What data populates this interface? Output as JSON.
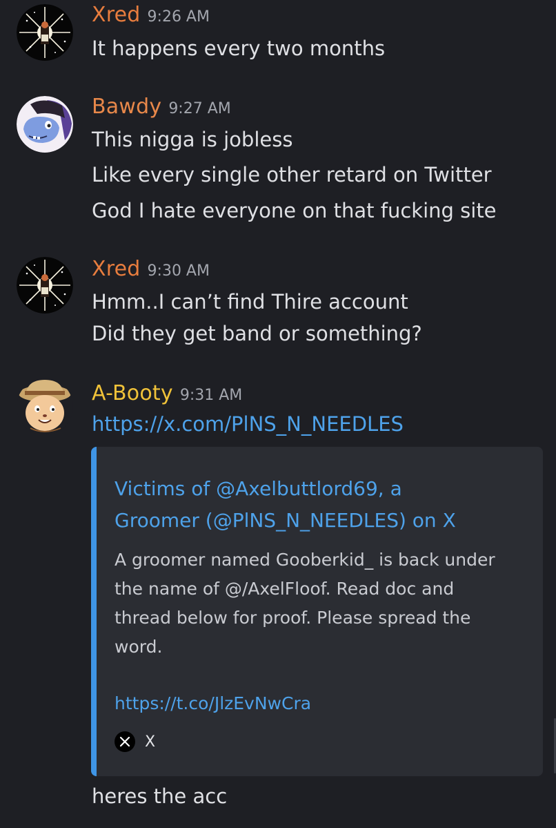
{
  "messages": [
    {
      "username": "Xred",
      "username_color": "#e87d3e",
      "timestamp": "9:26 AM",
      "lines": [
        "It happens every two months"
      ]
    },
    {
      "username": "Bawdy",
      "username_color": "#e8884a",
      "timestamp": "9:27 AM",
      "lines": [
        "This nigga is jobless",
        "Like every single other retard on Twitter",
        "God I hate everyone on that fucking site"
      ]
    },
    {
      "username": "Xred",
      "username_color": "#e87d3e",
      "timestamp": "9:30 AM",
      "lines": [
        "Hmm..I can’t find Thire account",
        "Did they get band or something?"
      ]
    },
    {
      "username": "A-Booty",
      "username_color": "#f0c239",
      "timestamp": "9:31 AM",
      "link": "https://x.com/PlNS_N_NEEDLES",
      "embed": {
        "title_lines": [
          "Victims of @Axelbuttlord69, a",
          "Groomer (@PlNS_N_NEEDLES) on X"
        ],
        "description_lines": [
          "A groomer named Gooberkid_ is back under",
          "the name of @/AxelFloof. Read doc and",
          "thread below for proof. Please spread the",
          "word."
        ],
        "link": "https://t.co/JlzEvNwCra",
        "footer": "X",
        "footer_icon": "x-logo-icon"
      },
      "after_text": "heres the acc"
    }
  ],
  "colors": {
    "background": "#1e1f24",
    "embed_background": "#2b2d33",
    "embed_accent": "#3f95e6",
    "link": "#4ea2ea"
  }
}
